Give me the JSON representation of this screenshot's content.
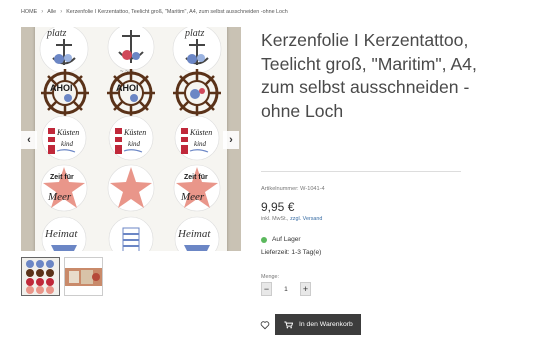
{
  "breadcrumb": {
    "items": [
      "HOME",
      "Alle",
      "Kerzenfolie I Kerzentattoo, Teelicht groß, \"Maritim\", A4, zum selbst ausschneiden -ohne Loch"
    ]
  },
  "product": {
    "title": "Kerzenfolie I Kerzentattoo, Teelicht groß, \"Maritim\", A4, zum selbst ausschneiden -ohne Loch",
    "article_number": "Artikelnummer: W-1041-4",
    "price": "9,95 €",
    "tax_prefix": "inkl. MwSt.,",
    "shipping_link": "zzgl. Versand",
    "availability": "Auf Lager",
    "delivery_time": "Lieferzeit: 1-3 Tag(e)",
    "quantity_label": "Menge:",
    "quantity": "1",
    "minus": "−",
    "plus": "+",
    "cart_button": "In den Warenkorb"
  },
  "image_text": {
    "platz": "platz",
    "ahoi": "AHOI",
    "kusten": "Küsten",
    "kind": "kind",
    "zeit": "Zeit für",
    "meer": "Meer",
    "heimat": "Heimat"
  },
  "gallery": {
    "prev_arrow": "‹",
    "next_arrow": "›"
  },
  "colors": {
    "accent": "#3c3c3c",
    "stock_green": "#5bb85d",
    "link_blue": "#3a6ea5"
  }
}
